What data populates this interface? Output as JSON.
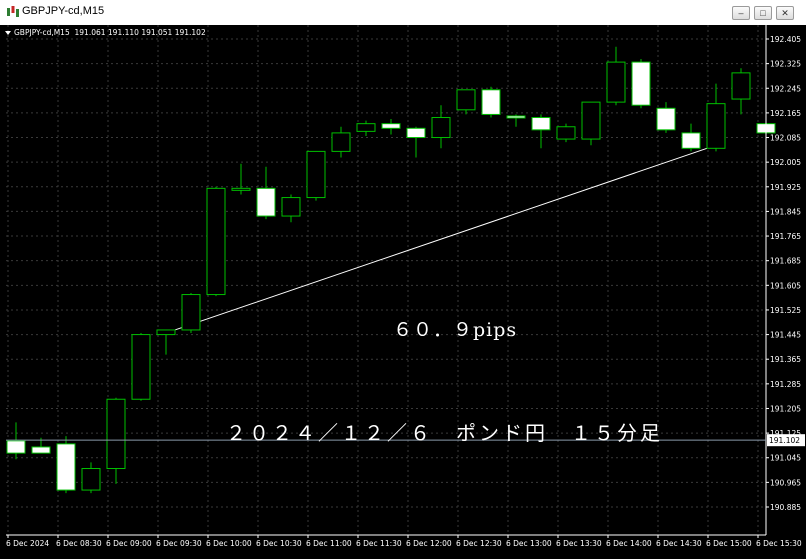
{
  "window": {
    "title": "GBPJPY-cd,M15",
    "minimize_label": "–",
    "maximize_label": "□",
    "close_label": "✕",
    "icon": "candlestick-chart-icon"
  },
  "header": {
    "symbol": "GBPJPY-cd,M15",
    "ohlc": "191.061 191.110 191.051 191.102"
  },
  "annotations": {
    "pips": "６０．９pips",
    "title": "２０２４／１２／６　ポンド円　１５分足"
  },
  "colors": {
    "background": "#000000",
    "grid": "#3a3a3a",
    "bull": "#00c000",
    "bear_fill": "#ffffff",
    "axis_text": "#ffffff",
    "trendline": "#ffffff"
  },
  "chart_data": {
    "type": "candlestick",
    "symbol": "GBPJPY-cd",
    "timeframe": "M15",
    "ylim": [
      190.84,
      192.44
    ],
    "y_ticks": [
      "192.405",
      "192.325",
      "192.245",
      "192.165",
      "192.085",
      "192.005",
      "191.925",
      "191.845",
      "191.765",
      "191.685",
      "191.605",
      "191.525",
      "191.445",
      "191.365",
      "191.285",
      "191.205",
      "191.125",
      "191.045",
      "190.965",
      "190.885"
    ],
    "x_ticks": [
      "6 Dec 2024",
      "6 Dec 08:30",
      "6 Dec 09:00",
      "6 Dec 09:30",
      "6 Dec 10:00",
      "6 Dec 10:30",
      "6 Dec 11:00",
      "6 Dec 11:30",
      "6 Dec 12:00",
      "6 Dec 12:30",
      "6 Dec 13:00",
      "6 Dec 13:30",
      "6 Dec 14:00",
      "6 Dec 14:30",
      "6 Dec 15:00",
      "6 Dec 15:30"
    ],
    "current_price": "191.102",
    "candles": [
      {
        "o": 191.1,
        "h": 191.16,
        "l": 191.04,
        "c": 191.06
      },
      {
        "o": 191.08,
        "h": 191.11,
        "l": 191.06,
        "c": 191.06
      },
      {
        "o": 191.09,
        "h": 191.115,
        "l": 190.93,
        "c": 190.94
      },
      {
        "o": 190.94,
        "h": 191.03,
        "l": 190.93,
        "c": 191.01
      },
      {
        "o": 191.01,
        "h": 191.24,
        "l": 190.96,
        "c": 191.235
      },
      {
        "o": 191.235,
        "h": 191.45,
        "l": 191.23,
        "c": 191.445
      },
      {
        "o": 191.445,
        "h": 191.46,
        "l": 191.38,
        "c": 191.46
      },
      {
        "o": 191.46,
        "h": 191.58,
        "l": 191.45,
        "c": 191.575
      },
      {
        "o": 191.575,
        "h": 191.925,
        "l": 191.57,
        "c": 191.92
      },
      {
        "o": 191.92,
        "h": 192.0,
        "l": 191.9,
        "c": 191.92
      },
      {
        "o": 191.92,
        "h": 191.99,
        "l": 191.82,
        "c": 191.83
      },
      {
        "o": 191.83,
        "h": 191.9,
        "l": 191.81,
        "c": 191.89
      },
      {
        "o": 191.89,
        "h": 192.04,
        "l": 191.88,
        "c": 192.04
      },
      {
        "o": 192.04,
        "h": 192.12,
        "l": 192.02,
        "c": 192.1
      },
      {
        "o": 192.105,
        "h": 192.14,
        "l": 192.09,
        "c": 192.13
      },
      {
        "o": 192.13,
        "h": 192.145,
        "l": 192.095,
        "c": 192.115
      },
      {
        "o": 192.115,
        "h": 192.12,
        "l": 192.02,
        "c": 192.085
      },
      {
        "o": 192.085,
        "h": 192.19,
        "l": 192.05,
        "c": 192.15
      },
      {
        "o": 192.175,
        "h": 192.24,
        "l": 192.16,
        "c": 192.24
      },
      {
        "o": 192.24,
        "h": 192.25,
        "l": 192.15,
        "c": 192.16
      },
      {
        "o": 192.155,
        "h": 192.16,
        "l": 192.12,
        "c": 192.15
      },
      {
        "o": 192.15,
        "h": 192.16,
        "l": 192.05,
        "c": 192.11
      },
      {
        "o": 192.08,
        "h": 192.13,
        "l": 192.07,
        "c": 192.12
      },
      {
        "o": 192.08,
        "h": 192.2,
        "l": 192.06,
        "c": 192.2
      },
      {
        "o": 192.2,
        "h": 192.38,
        "l": 192.19,
        "c": 192.33
      },
      {
        "o": 192.33,
        "h": 192.34,
        "l": 192.18,
        "c": 192.19
      },
      {
        "o": 192.18,
        "h": 192.2,
        "l": 192.1,
        "c": 192.11
      },
      {
        "o": 192.1,
        "h": 192.13,
        "l": 192.04,
        "c": 192.05
      },
      {
        "o": 192.05,
        "h": 192.26,
        "l": 192.04,
        "c": 192.195
      },
      {
        "o": 192.21,
        "h": 192.31,
        "l": 192.16,
        "c": 192.295
      },
      {
        "o": 192.13,
        "h": 192.14,
        "l": 192.095,
        "c": 192.1
      }
    ],
    "trendline": {
      "from_candle": 6,
      "from_price": 191.46,
      "to_candle": 28,
      "to_price": 192.05
    }
  }
}
